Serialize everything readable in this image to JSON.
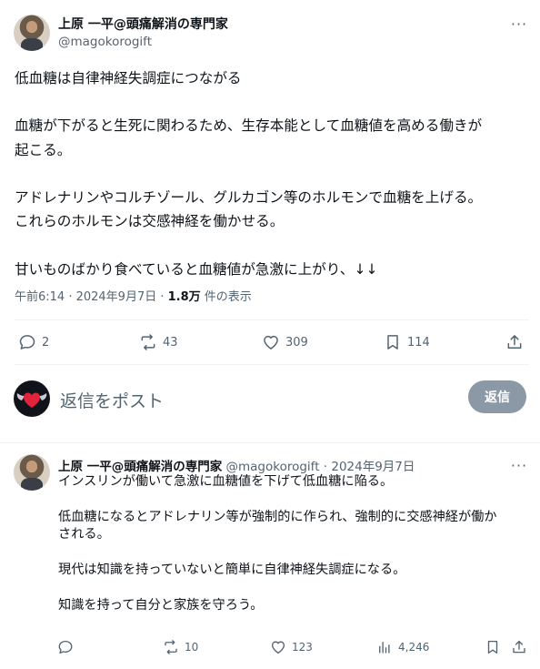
{
  "post": {
    "author_name": "上原 一平@頭痛解消の専門家",
    "author_handle": "@magokorogift",
    "text": "低血糖は自律神経失調症につながる\n\n血糖が下がると生死に関わるため、生存本能として血糖値を高める働きが\n起こる。\n\nアドレナリンやコルチゾール、グルカゴン等のホルモンで血糖を上げる。\nこれらのホルモンは交感神経を働かせる。\n\n甘いものばかり食べていると血糖値が急激に上がり、↓↓",
    "timestamp": "午前6:14 · 2024年9月7日 · ",
    "views": "1.8万",
    "views_suffix": " 件の表示",
    "stats": {
      "replies": "2",
      "reposts": "43",
      "likes": "309",
      "bookmarks": "114"
    }
  },
  "composer": {
    "placeholder": "返信をポスト",
    "button": "返信"
  },
  "reply": {
    "author_name": "上原 一平@頭痛解消の専門家",
    "author_sub": " @magokorogift · 2024年9月7日",
    "text": "インスリンが働いて急激に血糖値を下げて低血糖に陥る。\n\n低血糖になるとアドレナリン等が強制的に作られ、強制的に交感神経が働か\nされる。\n\n現代は知識を持っていないと簡単に自律神経失調症になる。\n\n知識を持って自分と家族を守ろう。",
    "stats": {
      "replies": "",
      "reposts": "10",
      "likes": "123",
      "views": "4,246"
    }
  },
  "icons": {
    "more": "more-icon",
    "reply": "reply-icon",
    "repost": "repost-icon",
    "like": "like-icon",
    "bookmark": "bookmark-icon",
    "share": "share-icon",
    "views": "views-icon"
  }
}
